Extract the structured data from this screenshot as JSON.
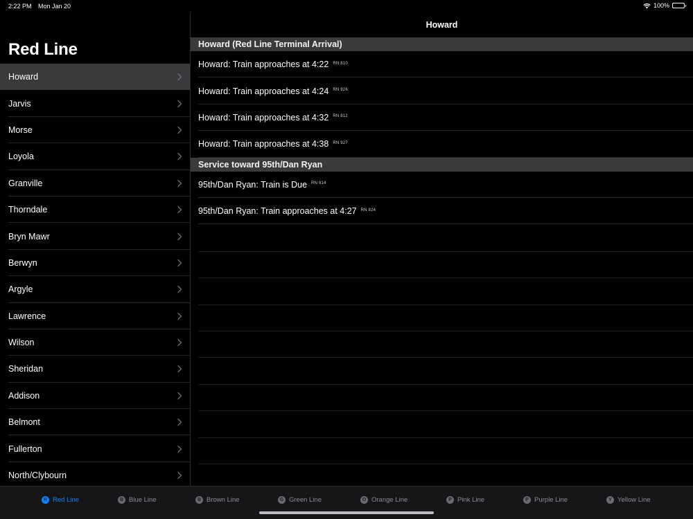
{
  "status": {
    "time": "2:22 PM",
    "date": "Mon Jan 20",
    "battery": "100%"
  },
  "sidebar": {
    "title": "Red Line",
    "stations": [
      "Howard",
      "Jarvis",
      "Morse",
      "Loyola",
      "Granville",
      "Thorndale",
      "Bryn Mawr",
      "Berwyn",
      "Argyle",
      "Lawrence",
      "Wilson",
      "Sheridan",
      "Addison",
      "Belmont",
      "Fullerton",
      "North/Clybourn"
    ],
    "selected": "Howard"
  },
  "detail": {
    "title": "Howard",
    "sections": [
      {
        "header": "Howard (Red Line Terminal Arrival)",
        "rows": [
          {
            "text": "Howard:  Train approaches at 4:22",
            "run": "RN 810"
          },
          {
            "text": "Howard:  Train approaches at 4:24",
            "run": "RN 926"
          },
          {
            "text": "Howard:  Train approaches at 4:32",
            "run": "RN 812"
          },
          {
            "text": "Howard:  Train approaches at 4:38",
            "run": "RN 927"
          }
        ]
      },
      {
        "header": "Service toward 95th/Dan Ryan",
        "rows": [
          {
            "text": "95th/Dan Ryan:  Train is Due",
            "run": "RN 914"
          },
          {
            "text": "95th/Dan Ryan:  Train approaches at 4:27",
            "run": "RN 824"
          }
        ]
      }
    ]
  },
  "tabs": [
    {
      "letter": "R",
      "label": "Red Line",
      "active": true
    },
    {
      "letter": "B",
      "label": "Blue Line"
    },
    {
      "letter": "B",
      "label": "Brown Line"
    },
    {
      "letter": "G",
      "label": "Green Line"
    },
    {
      "letter": "O",
      "label": "Orange Line"
    },
    {
      "letter": "P",
      "label": "Pink Line"
    },
    {
      "letter": "P",
      "label": "Purple Line"
    },
    {
      "letter": "Y",
      "label": "Yellow Line"
    }
  ],
  "colors": {
    "accent": "#0a84ff",
    "background": "#000000",
    "section_header": "#3a3a3c",
    "selected_row": "#3a3a3c"
  }
}
